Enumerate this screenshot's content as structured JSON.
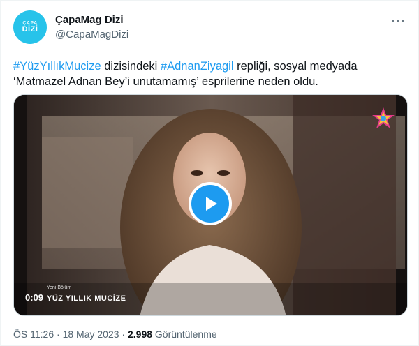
{
  "author": {
    "name": "ÇapaMag Dizi",
    "handle": "@CapaMagDizi",
    "avatar_top": "ÇAPA",
    "avatar_bottom": "DİZİ"
  },
  "more_menu": "···",
  "tweet": {
    "hashtag1": "#YüzYıllıkMucize",
    "text1": " dizisindeki ",
    "hashtag2": "#AdnanZiyagil",
    "text2": " repliği, sosyal medyada ‘Matmazel Adnan Bey’i unutamamış’ esprilerine neden oldu."
  },
  "video": {
    "duration": "0:09",
    "overlay_sub": "Yeni Bölüm",
    "overlay_title": "YÜZ YILLIK MUCİZE",
    "play_icon": "play-icon",
    "logo_icon": "star-tv-logo"
  },
  "meta": {
    "time": "ÖS 11:26",
    "sep1": " · ",
    "date": "18 May 2023",
    "sep2": " · ",
    "views_count": "2.998",
    "views_label": " Görüntülenme"
  },
  "colors": {
    "link": "#1d9bf0",
    "secondary": "#536471",
    "avatar_bg": "#27c3ea"
  }
}
